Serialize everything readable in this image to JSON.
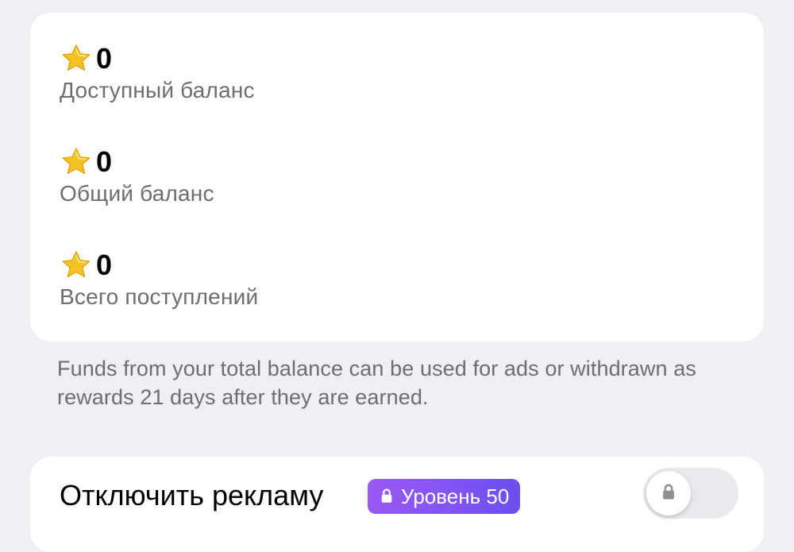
{
  "colors": {
    "background": "#efeff4",
    "card": "#ffffff",
    "value": "#000000",
    "label": "#6d6d72",
    "star": "#f5c225",
    "badge_start": "#9b59f5",
    "badge_end": "#6b4ff0"
  },
  "balances": [
    {
      "icon": "star-icon",
      "value": "0",
      "label": "Доступный баланс"
    },
    {
      "icon": "star-icon",
      "value": "0",
      "label": "Общий баланс"
    },
    {
      "icon": "star-icon",
      "value": "0",
      "label": "Всего поступлений"
    }
  ],
  "info": {
    "text": "Funds from your total balance can be used for ads or withdrawn as rewards 21 days after they are earned."
  },
  "ads": {
    "title": "Отключить рекламу",
    "badge_icon": "lock-icon",
    "badge_label": "Уровень 50",
    "toggle_icon": "lock-icon",
    "toggle_on": false
  }
}
